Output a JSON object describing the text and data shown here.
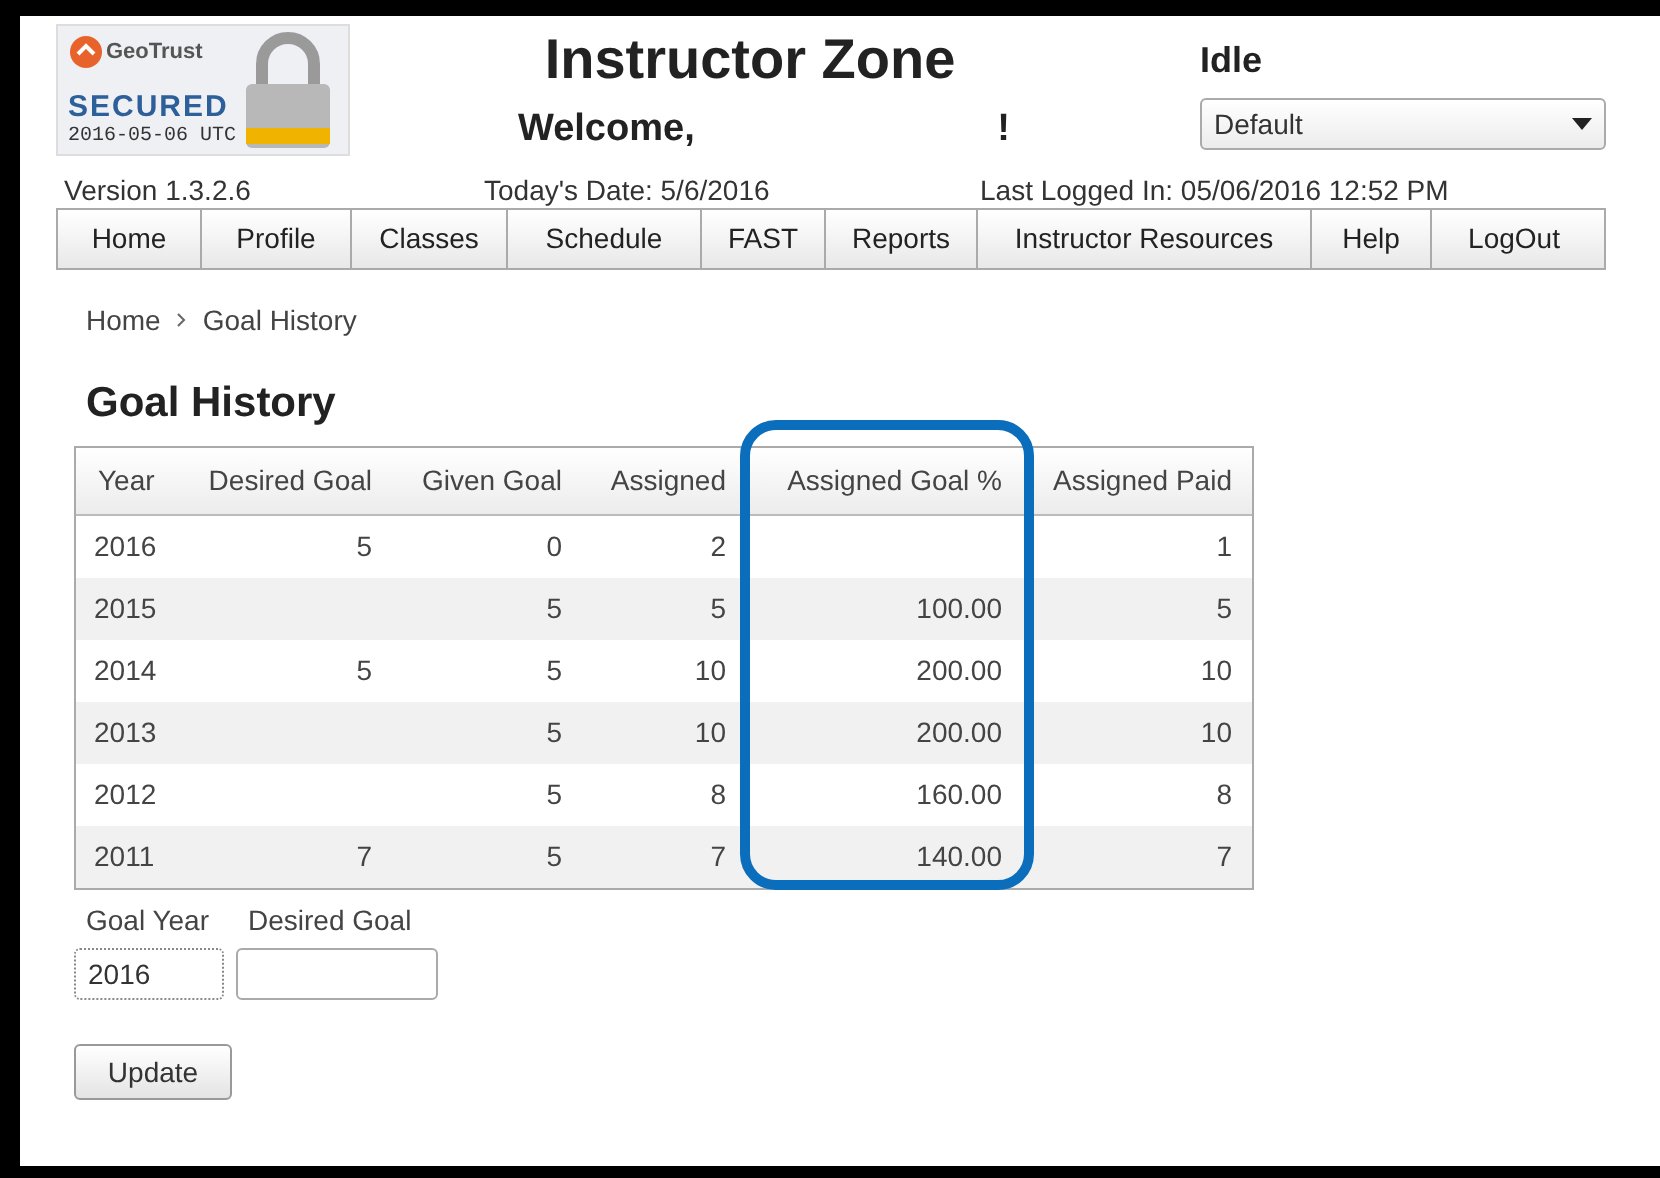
{
  "seal": {
    "brand": "GeoTrust",
    "label": "SECURED",
    "date": "2016-05-06 UTC"
  },
  "header": {
    "title": "Instructor Zone",
    "welcome": "Welcome,",
    "welcome_end": "!",
    "status": "Idle",
    "dropdown": {
      "value": "Default"
    }
  },
  "info": {
    "version": "Version 1.3.2.6",
    "today": "Today's Date:  5/6/2016",
    "last_login": "Last Logged In:  05/06/2016 12:52 PM"
  },
  "nav": [
    "Home",
    "Profile",
    "Classes",
    "Schedule",
    "FAST",
    "Reports",
    "Instructor Resources",
    "Help",
    "LogOut"
  ],
  "breadcrumb": [
    "Home",
    "Goal History"
  ],
  "heading": "Goal History",
  "table": {
    "columns": [
      {
        "label": "Year",
        "highlighted": false
      },
      {
        "label": "Desired Goal",
        "highlighted": false
      },
      {
        "label": "Given Goal",
        "highlighted": false
      },
      {
        "label": "Assigned",
        "highlighted": false
      },
      {
        "label": "Assigned Goal %",
        "highlighted": true
      },
      {
        "label": "Assigned Paid",
        "highlighted": false
      }
    ],
    "rows": [
      [
        "2016",
        "5",
        "0",
        "2",
        "",
        "1"
      ],
      [
        "2015",
        "",
        "5",
        "5",
        "100.00",
        "5"
      ],
      [
        "2014",
        "5",
        "5",
        "10",
        "200.00",
        "10"
      ],
      [
        "2013",
        "",
        "5",
        "10",
        "200.00",
        "10"
      ],
      [
        "2012",
        "",
        "5",
        "8",
        "160.00",
        "8"
      ],
      [
        "2011",
        "7",
        "5",
        "7",
        "140.00",
        "7"
      ]
    ]
  },
  "form": {
    "fields": [
      {
        "label": "Goal Year",
        "value": "2016",
        "focused": true
      },
      {
        "label": "Desired Goal",
        "focused": false
      }
    ],
    "button": "Update"
  }
}
